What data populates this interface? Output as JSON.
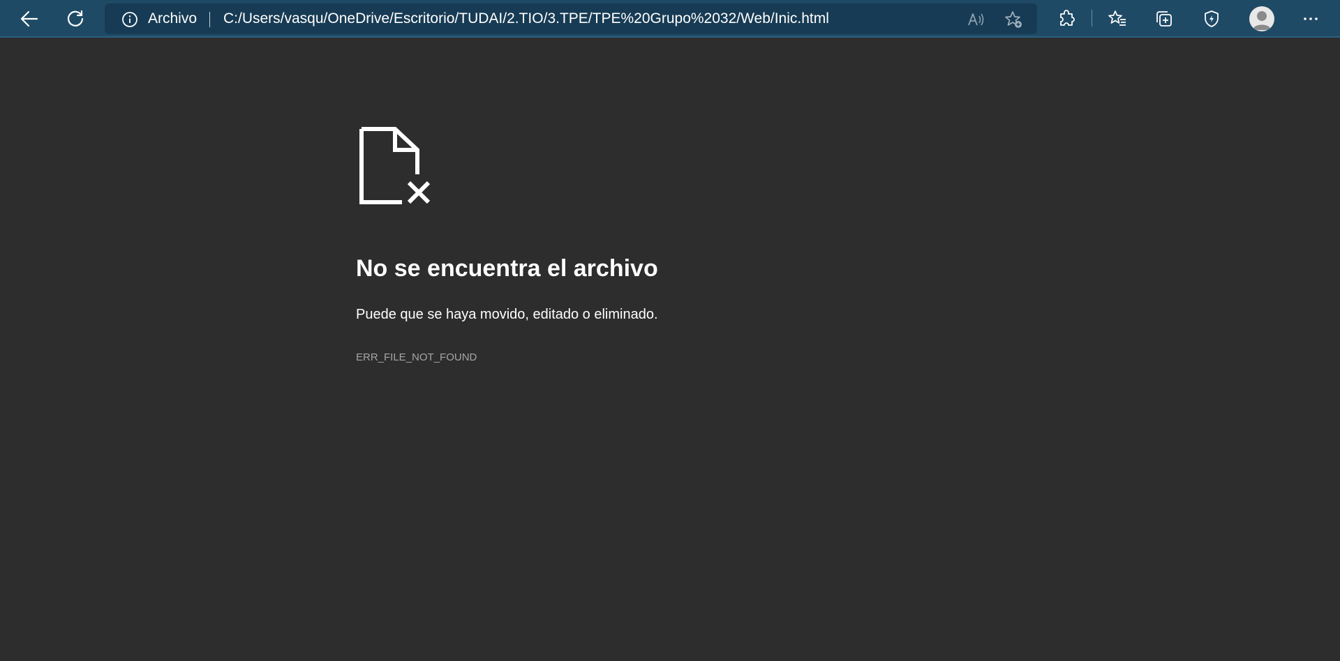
{
  "browser": {
    "toolbar_color": "#1f4a66",
    "address_bar": {
      "origin_label": "Archivo",
      "url": "C:/Users/vasqu/OneDrive/Escritorio/TUDAI/2.TIO/3.TPE/TPE%20Grupo%2032/Web/Inic.html"
    },
    "icons": [
      "back-icon",
      "refresh-icon",
      "info-icon",
      "read-aloud-icon",
      "add-favorite-icon",
      "extensions-icon",
      "favorites-icon",
      "collections-icon",
      "browser-essentials-icon",
      "profile-avatar",
      "more-icon"
    ]
  },
  "error_page": {
    "icon": "file-not-found-icon",
    "title": "No se encuentra el archivo",
    "description": "Puede que se haya movido, editado o eliminado.",
    "code": "ERR_FILE_NOT_FOUND",
    "background": "#2d2d2d"
  }
}
